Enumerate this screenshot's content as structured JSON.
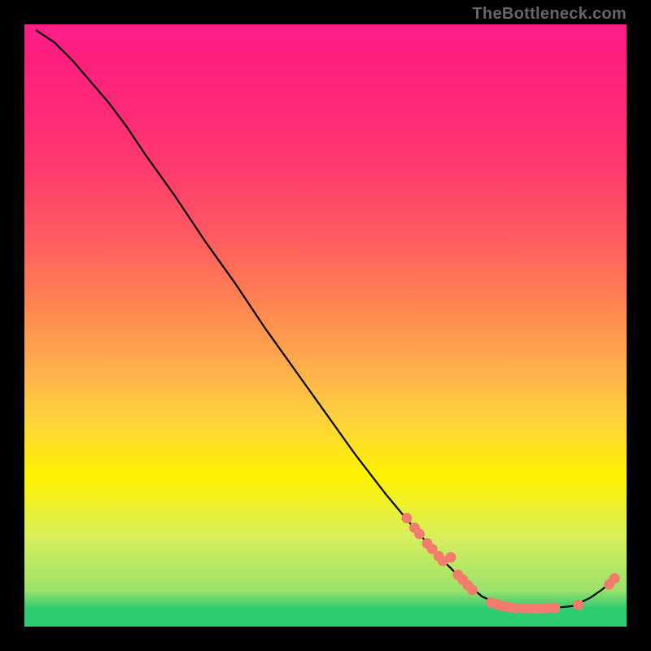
{
  "watermark": "TheBottleneck.com",
  "chart_data": {
    "type": "line",
    "title": "",
    "xlabel": "",
    "ylabel": "",
    "xlim": [
      0,
      100
    ],
    "ylim": [
      0,
      100
    ],
    "curve": [
      {
        "x": 2,
        "y": 99
      },
      {
        "x": 5,
        "y": 97
      },
      {
        "x": 8,
        "y": 94
      },
      {
        "x": 11,
        "y": 90.5
      },
      {
        "x": 14,
        "y": 87
      },
      {
        "x": 17,
        "y": 83
      },
      {
        "x": 20,
        "y": 78.5
      },
      {
        "x": 25,
        "y": 71.5
      },
      {
        "x": 30,
        "y": 64
      },
      {
        "x": 35,
        "y": 57
      },
      {
        "x": 40,
        "y": 49.5
      },
      {
        "x": 45,
        "y": 42.5
      },
      {
        "x": 50,
        "y": 35.5
      },
      {
        "x": 55,
        "y": 28.5
      },
      {
        "x": 60,
        "y": 22
      },
      {
        "x": 65,
        "y": 16
      },
      {
        "x": 70,
        "y": 10.5
      },
      {
        "x": 73,
        "y": 7.5
      },
      {
        "x": 76,
        "y": 5
      },
      {
        "x": 79,
        "y": 3.6
      },
      {
        "x": 82,
        "y": 3.1
      },
      {
        "x": 85,
        "y": 3.0
      },
      {
        "x": 88,
        "y": 3.1
      },
      {
        "x": 91,
        "y": 3.4
      },
      {
        "x": 94,
        "y": 4.8
      },
      {
        "x": 96,
        "y": 6.2
      },
      {
        "x": 98,
        "y": 8.0
      }
    ],
    "scatter": [
      {
        "x": 63.5,
        "y": 18.0
      },
      {
        "x": 64.8,
        "y": 16.4
      },
      {
        "x": 65.6,
        "y": 15.4
      },
      {
        "x": 66.9,
        "y": 13.8
      },
      {
        "x": 67.7,
        "y": 12.9
      },
      {
        "x": 68.8,
        "y": 11.7
      },
      {
        "x": 69.5,
        "y": 10.9
      },
      {
        "x": 70.8,
        "y": 11.5
      },
      {
        "x": 72.0,
        "y": 8.6
      },
      {
        "x": 72.8,
        "y": 7.8
      },
      {
        "x": 73.6,
        "y": 6.9
      },
      {
        "x": 74.4,
        "y": 6.1
      },
      {
        "x": 77.5,
        "y": 4.0
      },
      {
        "x": 78.5,
        "y": 3.7
      },
      {
        "x": 79.5,
        "y": 3.4
      },
      {
        "x": 80.6,
        "y": 3.2
      },
      {
        "x": 81.6,
        "y": 3.1
      },
      {
        "x": 83.0,
        "y": 3.0
      },
      {
        "x": 84.0,
        "y": 3.0
      },
      {
        "x": 85.0,
        "y": 3.0
      },
      {
        "x": 86.0,
        "y": 3.0
      },
      {
        "x": 87.0,
        "y": 3.1
      },
      {
        "x": 88.1,
        "y": 3.1
      },
      {
        "x": 92.0,
        "y": 3.6
      },
      {
        "x": 97.1,
        "y": 7.0
      },
      {
        "x": 98.0,
        "y": 8.0
      }
    ],
    "marker_color": "#f37c6e",
    "line_color": "#000000"
  }
}
